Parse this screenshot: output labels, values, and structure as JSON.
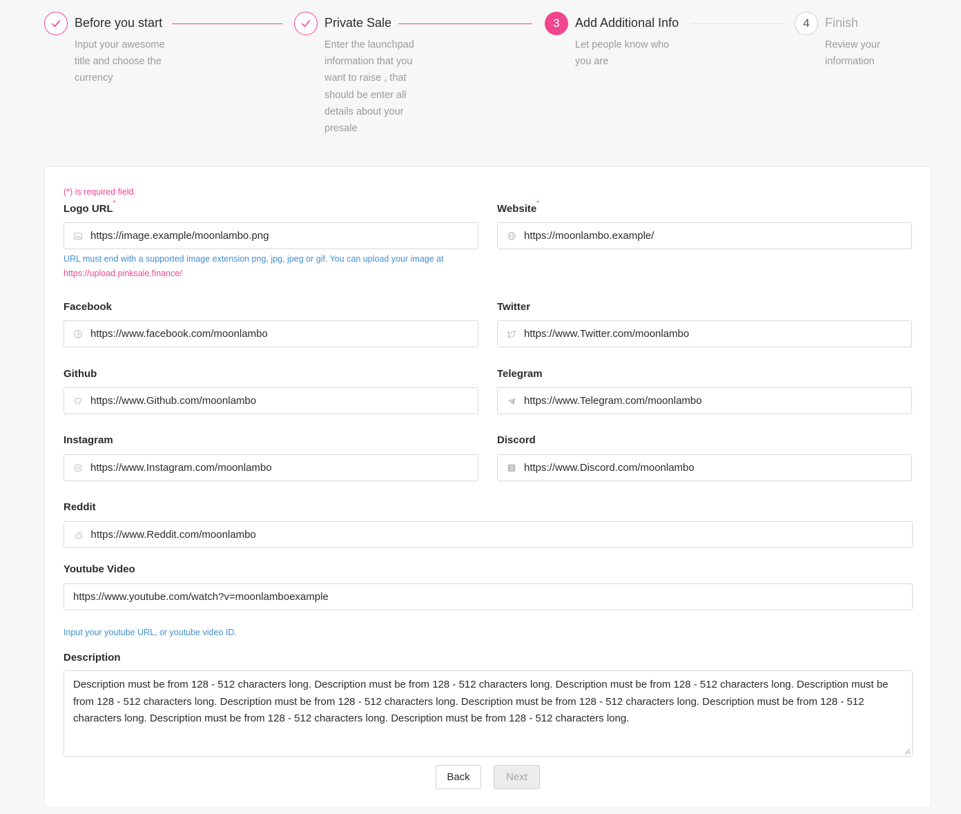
{
  "steps": [
    {
      "title": "Before you start",
      "desc": "Input your awesome title and choose the currency",
      "status": "done"
    },
    {
      "title": "Private Sale",
      "desc": "Enter the launchpad information that you want to raise , that should be enter all details about your presale",
      "status": "done"
    },
    {
      "number": "3",
      "title": "Add Additional Info",
      "desc": "Let people know who you are",
      "status": "active"
    },
    {
      "number": "4",
      "title": "Finish",
      "desc": "Review your information",
      "status": "todo"
    }
  ],
  "form": {
    "required_note": "(*) is required field.",
    "logo": {
      "label": "Logo URL",
      "required_mark": "*",
      "value": "https://image.example/moonlambo.png",
      "icon": "image-icon",
      "help": "URL must end with a supported image extension png, jpg, jpeg or gif. You can upload your image at",
      "help_link": "https://upload.pinksale.finance/"
    },
    "website": {
      "label": "Website",
      "required_mark": "*",
      "value": "https://moonlambo.example/",
      "icon": "globe-icon"
    },
    "facebook": {
      "label": "Facebook",
      "value": "https://www.facebook.com/moonlambo",
      "icon": "facebook-icon"
    },
    "twitter": {
      "label": "Twitter",
      "value": "https://www.Twitter.com/moonlambo",
      "icon": "twitter-icon"
    },
    "github": {
      "label": "Github",
      "value": "https://www.Github.com/moonlambo",
      "icon": "github-icon"
    },
    "telegram": {
      "label": "Telegram",
      "value": "https://www.Telegram.com/moonlambo",
      "icon": "telegram-icon"
    },
    "instagram": {
      "label": "Instagram",
      "value": "https://www.Instagram.com/moonlambo",
      "icon": "instagram-icon"
    },
    "discord": {
      "label": "Discord",
      "value": "https://www.Discord.com/moonlambo",
      "icon": "discord-icon"
    },
    "reddit": {
      "label": "Reddit",
      "value": "https://www.Reddit.com/moonlambo",
      "icon": "reddit-icon"
    },
    "youtube": {
      "label": "Youtube Video",
      "value": "https://www.youtube.com/watch?v=moonlamboexample",
      "help": "Input your youtube URL, or youtube video ID."
    },
    "description": {
      "label": "Description",
      "value": "Description must be from 128 - 512 characters long. Description must be from 128 - 512 characters long. Description must be from 128 - 512 characters long. Description must be from 128 - 512 characters long. Description must be from 128 - 512 characters long. Description must be from 128 - 512 characters long. Description must be from 128 - 512 characters long. Description must be from 128 - 512 characters long. Description must be from 128 - 512 characters long."
    }
  },
  "buttons": {
    "back": "Back",
    "next": "Next"
  },
  "colors": {
    "accent": "#f0468f",
    "help_text": "#3f8fd2",
    "muted": "#9a9a9a"
  }
}
